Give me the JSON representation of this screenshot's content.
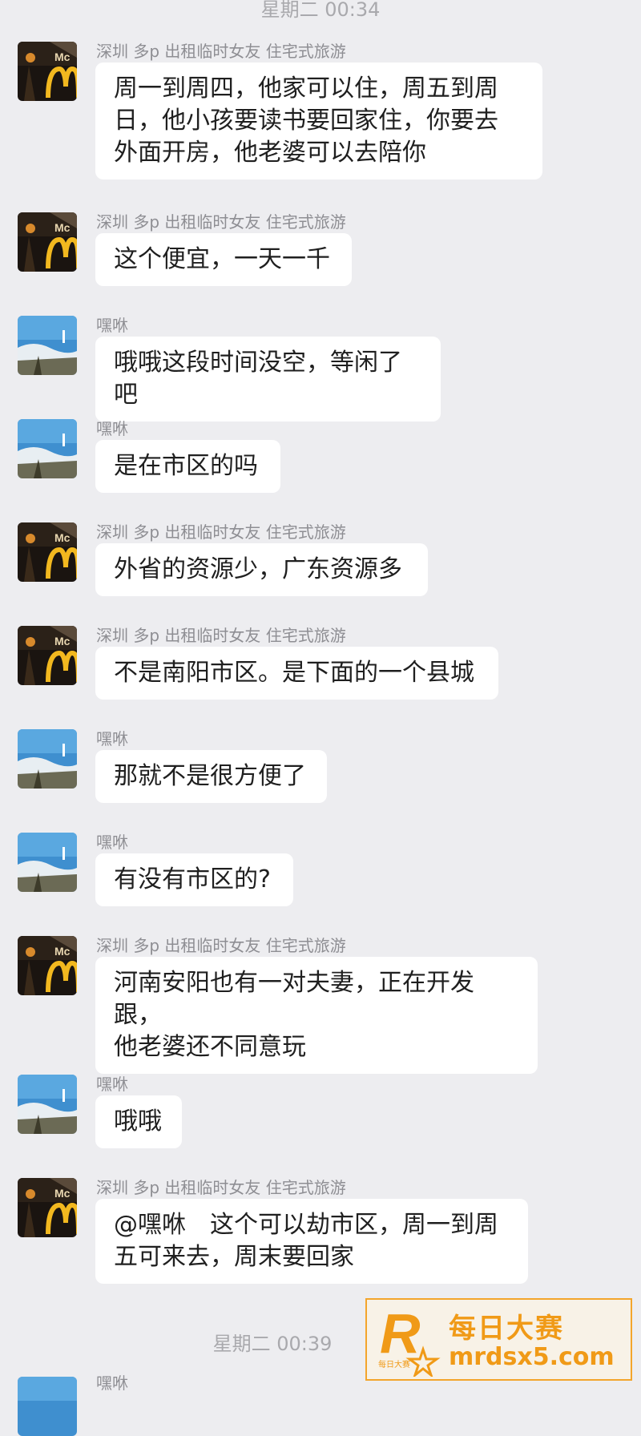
{
  "timestamps": [
    "星期二 00:34",
    "星期二 00:39"
  ],
  "sender_names": {
    "a": "深圳 多p 出租临时女友 住宅式旅游",
    "b": "嘿咻"
  },
  "messages": [
    {
      "sender": "深圳 多p 出租临时女友 住宅式旅游",
      "text": "周一到周四，他家可以住，周五到周\n日，他小孩要读书要回家住，你要去\n外面开房，他老婆可以去陪你"
    },
    {
      "sender": "深圳 多p 出租临时女友 住宅式旅游",
      "text": "这个便宜，一天一千"
    },
    {
      "sender": "嘿咻",
      "text": "哦哦这段时间没空，等闲了吧"
    },
    {
      "sender": "嘿咻",
      "text": "是在市区的吗"
    },
    {
      "sender": "深圳 多p 出租临时女友 住宅式旅游",
      "text": "外省的资源少，广东资源多"
    },
    {
      "sender": "深圳 多p 出租临时女友 住宅式旅游",
      "text": "不是南阳市区。是下面的一个县城"
    },
    {
      "sender": "嘿咻",
      "text": "那就不是很方便了"
    },
    {
      "sender": "嘿咻",
      "text": "有没有市区的?"
    },
    {
      "sender": "深圳 多p 出租临时女友 住宅式旅游",
      "text": "河南安阳也有一对夫妻，正在开发跟，\n他老婆还不同意玩"
    },
    {
      "sender": "嘿咻",
      "text": "哦哦"
    },
    {
      "sender": "深圳 多p 出租临时女友 住宅式旅游",
      "text": "@嘿咻　这个可以劫市区，周一到周\n五可来去，周末要回家"
    },
    {
      "sender": "嘿咻",
      "text": ""
    }
  ],
  "watermark": {
    "cn": "每日大赛",
    "url": "mrdsx5.com",
    "logo_small": "每日大赛",
    "logo_letter": "R"
  },
  "colors": {
    "background": "#ededf0",
    "bubble": "#ffffff",
    "watermark": "#f09a17"
  }
}
